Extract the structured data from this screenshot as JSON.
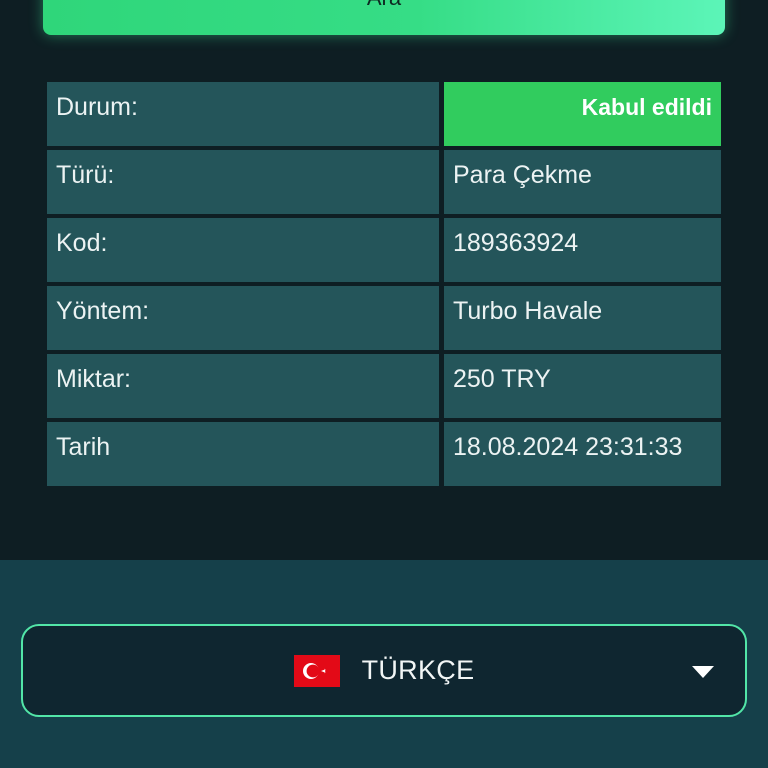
{
  "search": {
    "button_label": "Ara"
  },
  "details": {
    "rows": [
      {
        "label": "Durum:",
        "value": "Kabul edildi"
      },
      {
        "label": "Türü:",
        "value": "Para Çekme"
      },
      {
        "label": "Kod:",
        "value": "189363924"
      },
      {
        "label": "Yöntem:",
        "value": "Turbo Havale"
      },
      {
        "label": "Miktar:",
        "value": "250 TRY"
      },
      {
        "label": "Tarih",
        "value": "18.08.2024 23:31:33"
      }
    ]
  },
  "status_color": "#31cc5e",
  "language": {
    "selected": "TÜRKÇE",
    "flag_icon": "turkey-flag-icon"
  }
}
